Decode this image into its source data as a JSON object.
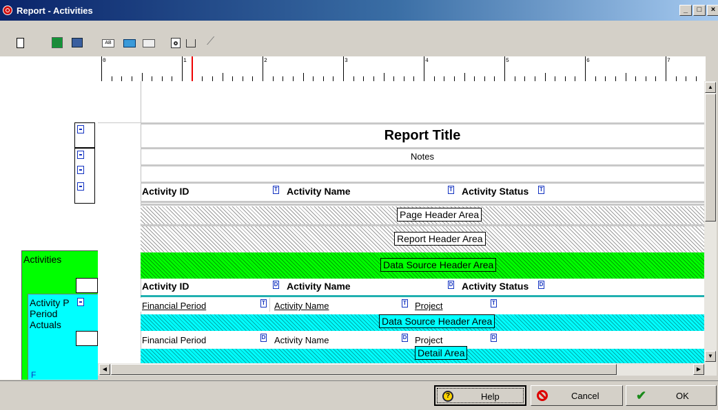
{
  "window": {
    "title": "Report - Activities",
    "controls": {
      "minimize": "_",
      "maximize": "□",
      "close": "×"
    },
    "app_icon": "oracle-icon"
  },
  "toolbar": {
    "items": [
      "new-report-icon",
      "data-source-icon",
      "data-source-2-icon",
      "text-field-icon",
      "image-icon",
      "field-icon",
      "preview-icon",
      "frame-icon",
      "wizard-icon"
    ],
    "text_field_glyph": "AB"
  },
  "ruler": {
    "numbers": [
      "0",
      "1",
      "2",
      "3",
      "4",
      "5",
      "6",
      "7"
    ]
  },
  "tree": {
    "group_label": "Activities",
    "sub_label_1": "Activity P",
    "sub_label_2": "Period",
    "sub_label_3": "Actuals",
    "bottom_glyph": "F"
  },
  "report": {
    "title": "Report Title",
    "notes": "Notes",
    "page_header_columns": [
      {
        "label": "Activity ID",
        "tag": "T"
      },
      {
        "label": "Activity Name",
        "tag": "T"
      },
      {
        "label": "Activity Status",
        "tag": "T"
      }
    ],
    "page_header_area": "Page Header Area",
    "report_header_area": "Report Header Area",
    "data_source_header_area": "Data Source Header Area",
    "ds_columns": [
      {
        "label": "Activity ID",
        "tag": "D"
      },
      {
        "label": "Activity Name",
        "tag": "D"
      },
      {
        "label": "Activity Status",
        "tag": "D"
      }
    ],
    "sub_header_fields": [
      {
        "label": "Financial Period",
        "tag": "T"
      },
      {
        "label": "Activity Name",
        "tag": "T"
      },
      {
        "label": "Project",
        "tag": "T"
      }
    ],
    "sub_data_source_header_area": "Data Source Header Area",
    "detail_fields": [
      {
        "label": "Financial Period",
        "tag": "D"
      },
      {
        "label": "Activity Name",
        "tag": "D"
      },
      {
        "label": "Project",
        "tag": "D"
      }
    ],
    "detail_area": "Detail Area"
  },
  "buttons": {
    "help": "Help",
    "cancel": "Cancel",
    "ok": "OK"
  },
  "colors": {
    "title_bar": "#0a246a",
    "data_source_band": "#00ff00",
    "sub_band": "#00ffff",
    "tag": "#1030c0"
  }
}
